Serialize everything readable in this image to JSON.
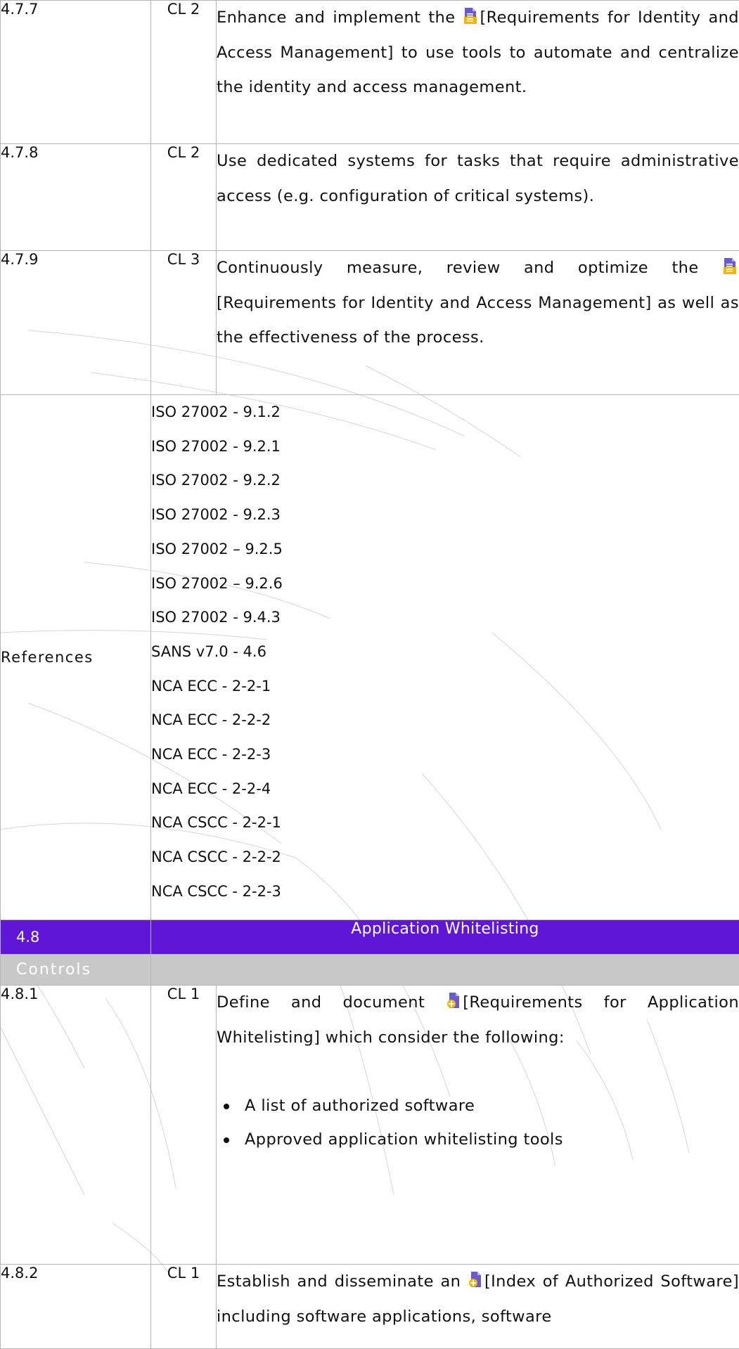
{
  "rows": [
    {
      "id": "4.7.7",
      "level": "CL 2",
      "text_before": "Enhance and implement the ",
      "icon": "document-icon",
      "text_after": "[Requirements for Identity and Access Management] to use tools to automate and centralize the identity and access management."
    },
    {
      "id": "4.7.8",
      "level": "CL 2",
      "text": "Use dedicated systems for tasks that require administrative access (e.g. configuration of critical systems)."
    },
    {
      "id": "4.7.9",
      "level": "CL 3",
      "text_before": "Continuously measure, review and optimize the ",
      "icon": "document-icon",
      "text_after": "[Requirements for Identity and Access Management] as well as the effectiveness of the process."
    }
  ],
  "references": {
    "label": "References",
    "items": [
      "ISO 27002 - 9.1.2",
      "ISO 27002 - 9.2.1",
      "ISO 27002 - 9.2.2",
      "ISO 27002 - 9.2.3",
      "ISO 27002 – 9.2.5",
      "ISO 27002 – 9.2.6",
      "ISO 27002 - 9.4.3",
      "SANS v7.0 - 4.6",
      "NCA ECC - 2-2-1",
      "NCA ECC - 2-2-2",
      "NCA ECC - 2-2-3",
      "NCA ECC - 2-2-4",
      "NCA CSCC - 2-2-1",
      "NCA CSCC - 2-2-2",
      "NCA CSCC - 2-2-3"
    ]
  },
  "section": {
    "id": "4.8",
    "title": "Application Whitelisting",
    "color": "#5f16d6"
  },
  "controls_label": "Controls",
  "rows2": [
    {
      "id": "4.8.1",
      "level": "CL 1",
      "text_before": "Define and document ",
      "icon": "new-document-icon",
      "text_after": "[Requirements for Application Whitelisting] which consider the following:",
      "bullets": [
        "A list of authorized software",
        "Approved application whitelisting tools"
      ]
    },
    {
      "id": "4.8.2",
      "level": "CL 1",
      "text_before": "Establish and disseminate an ",
      "icon": "new-document-icon",
      "text_after": "[Index of Authorized Software] including software applications, software"
    }
  ]
}
